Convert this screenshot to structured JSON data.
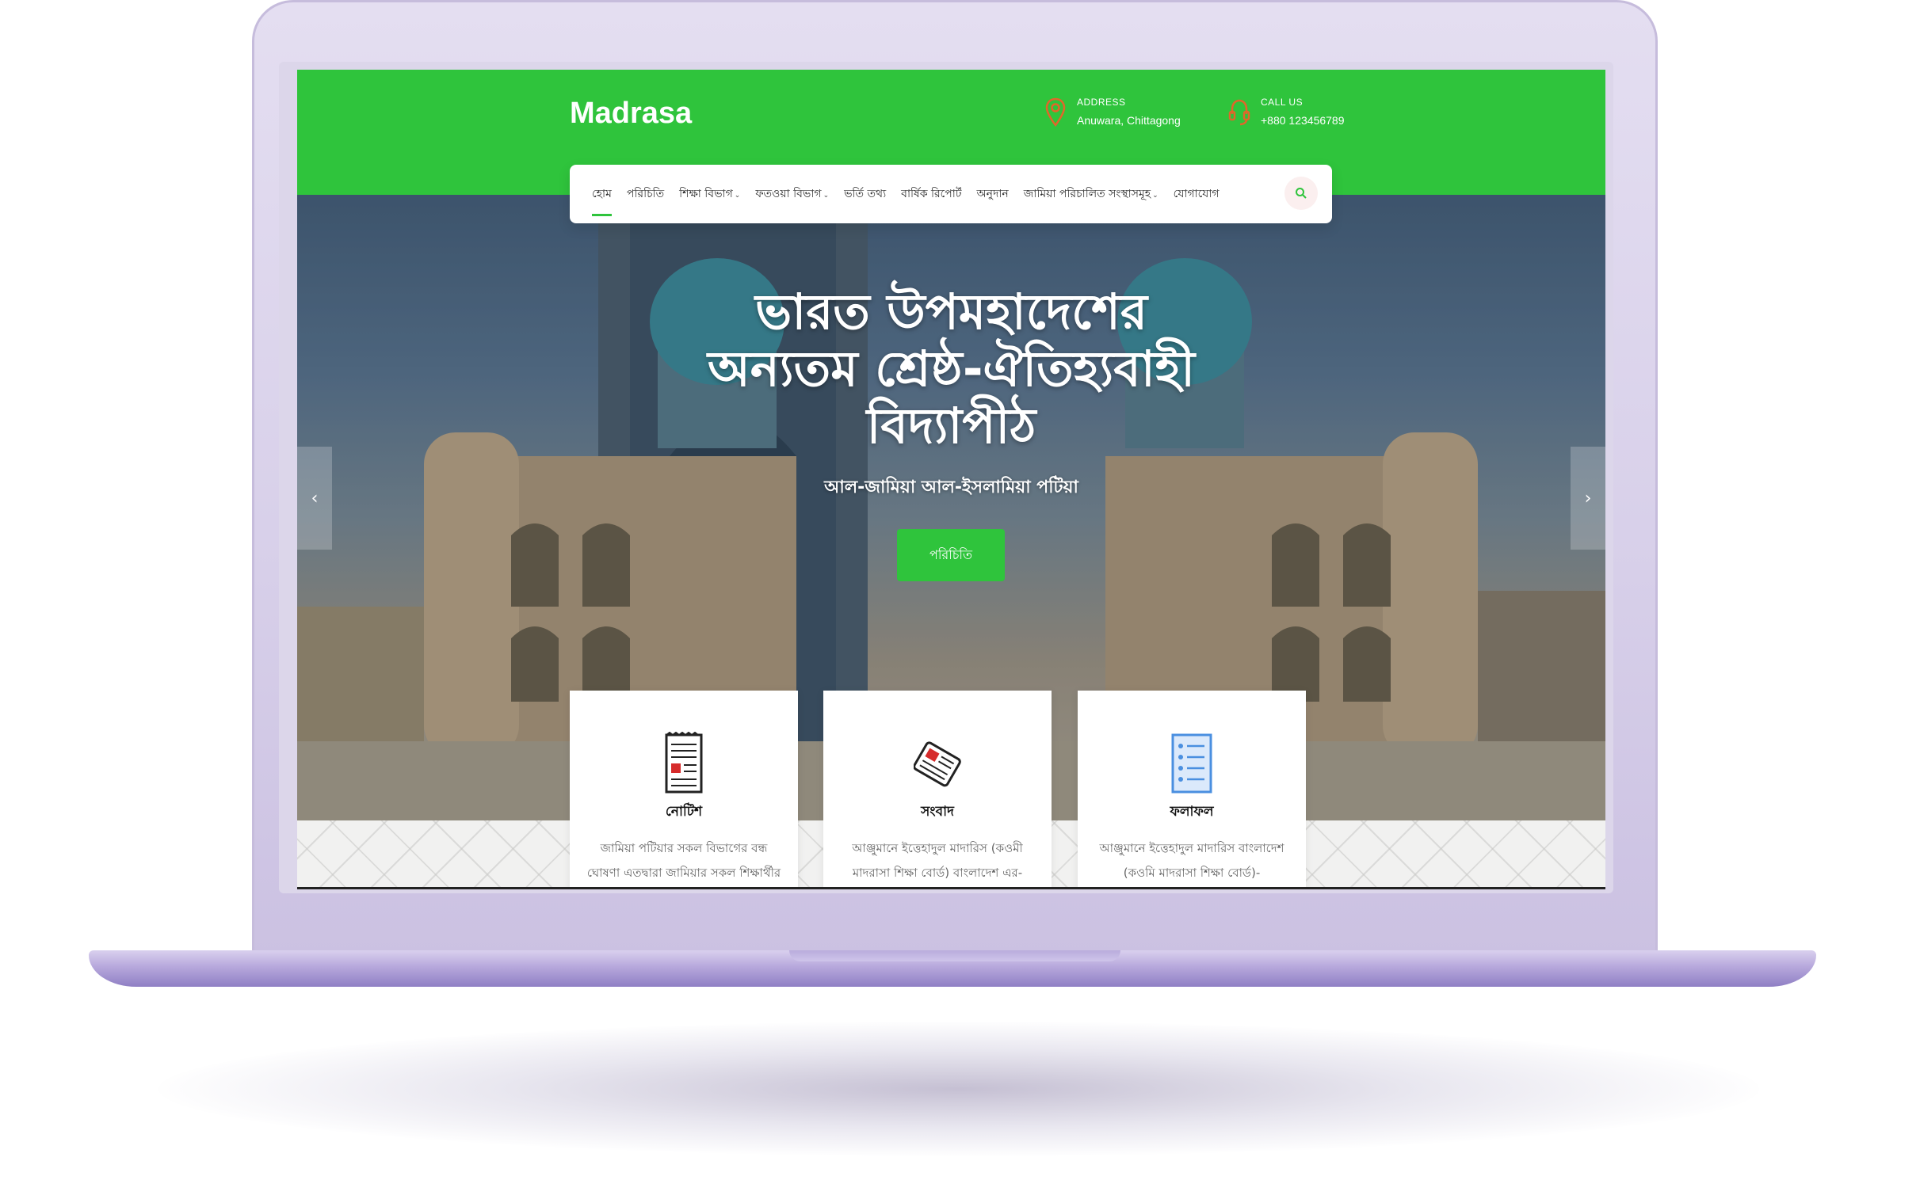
{
  "site": {
    "logo": "Madrasa",
    "address_label": "ADDRESS",
    "address_value": "Anuwara, Chittagong",
    "call_label": "CALL US",
    "call_value": "+880 123456789"
  },
  "nav": {
    "items": [
      {
        "label": "হোম",
        "active": true
      },
      {
        "label": "পরিচিতি"
      },
      {
        "label": "শিক্ষা বিভাগ",
        "dropdown": true
      },
      {
        "label": "ফতওয়া বিভাগ",
        "dropdown": true
      },
      {
        "label": "ভর্তি তথ্য"
      },
      {
        "label": "বার্ষিক রিপোর্ট"
      },
      {
        "label": "অনুদান"
      },
      {
        "label": "জামিয়া পরিচালিত সংস্থাসমূহ",
        "dropdown": true
      },
      {
        "label": "যোগাযোগ"
      }
    ],
    "search_icon": "search-icon"
  },
  "hero": {
    "title_line1": "ভারত উপমহাদেশের",
    "title_line2": "অন্যতম শ্রেষ্ঠ-ঐতিহ্যবাহী",
    "title_line3": "বিদ্যাপীঠ",
    "subtitle": "আল-জামিয়া আল-ইসলামিয়া পটিয়া",
    "button": "পরিচিতি",
    "prev_arrow": "‹",
    "next_arrow": "›"
  },
  "cards": [
    {
      "icon": "notice-document-icon",
      "title": "নোটিশ",
      "text": "জামিয়া পটিয়ার সকল বিভাগের বন্ধ ঘোষণা এতদ্বারা জামিয়ার সকল শিক্ষার্থীর"
    },
    {
      "icon": "newspaper-icon",
      "title": "সংবাদ",
      "text": "আঞ্জুমানে ইত্তেহাদুল মাদারিস (কওমী মাদরাসা শিক্ষা বোর্ড) বাংলাদেশ এর-"
    },
    {
      "icon": "result-checklist-icon",
      "title": "ফলাফল",
      "text": "আঞ্জুমানে ইত্তেহাদুল মাদারিস বাংলাদেশ (কওমি মাদরাসা শিক্ষা বোর্ড)-"
    }
  ],
  "colors": {
    "brand_green": "#2fc43c",
    "lid": "#dcd6ea",
    "icon_orange": "#e0672a"
  }
}
